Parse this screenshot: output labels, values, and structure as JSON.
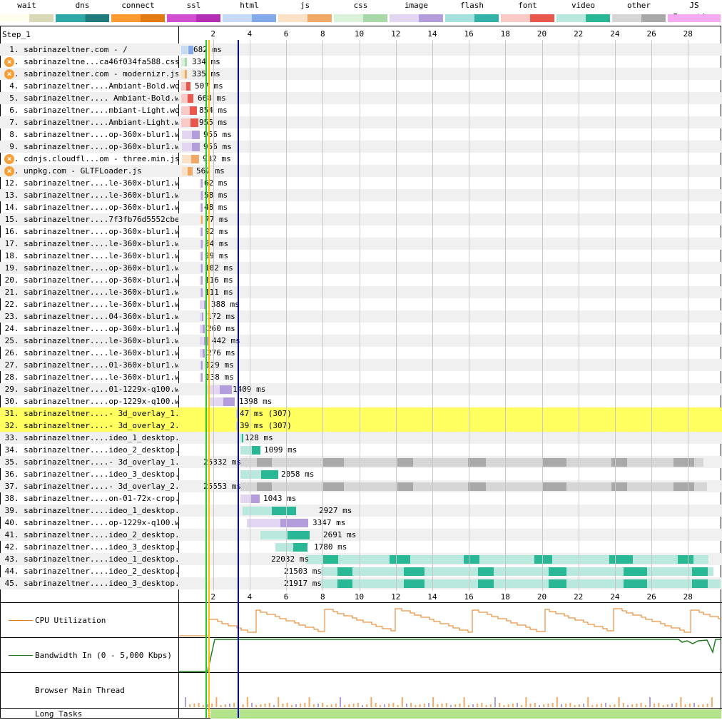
{
  "legend": [
    {
      "label": "wait",
      "colors": [
        "#fffded",
        "#d9d9b8"
      ]
    },
    {
      "label": "dns",
      "colors": [
        "#30a8a8",
        "#1f7a7a"
      ]
    },
    {
      "label": "connect",
      "colors": [
        "#ff9a33",
        "#e37b14"
      ]
    },
    {
      "label": "ssl",
      "colors": [
        "#d150d1",
        "#b52fb5"
      ]
    },
    {
      "label": "html",
      "colors": [
        "#c6d9f5",
        "#82a9e8"
      ]
    },
    {
      "label": "js",
      "colors": [
        "#fbe2c6",
        "#efa866"
      ]
    },
    {
      "label": "css",
      "colors": [
        "#d9f2d9",
        "#a9d9a9"
      ]
    },
    {
      "label": "image",
      "colors": [
        "#e2d6f2",
        "#b39ddb"
      ]
    },
    {
      "label": "flash",
      "colors": [
        "#a6e2dd",
        "#32b2a9"
      ]
    },
    {
      "label": "font",
      "colors": [
        "#f9c9c5",
        "#e8584d"
      ]
    },
    {
      "label": "video",
      "colors": [
        "#b8e8de",
        "#2ab795"
      ]
    },
    {
      "label": "other",
      "colors": [
        "#d6d6d6",
        "#a9a9a9"
      ]
    },
    {
      "label": "JS Execution",
      "colors": [
        "#f7a9f2",
        "#f7a9f2"
      ]
    }
  ],
  "step_title": "Step_1",
  "axis": {
    "ticks": [
      "2",
      "4",
      "6",
      "8",
      "10",
      "12",
      "14",
      "16",
      "18",
      "20",
      "22",
      "24",
      "26",
      "28"
    ]
  },
  "requests": [
    {
      "label": "  1. sabrinazeltner.com - /",
      "timing": "682 ms",
      "type": "html",
      "error": false,
      "highlight": false
    },
    {
      "label": "  2. sabrinazeltne...ca46f034fa588.css",
      "timing": "334 ms",
      "type": "css",
      "error": true,
      "highlight": false
    },
    {
      "label": "  3. sabrinazeltner.com - modernizr.js",
      "timing": "335 ms",
      "type": "js",
      "error": true,
      "highlight": false
    },
    {
      "label": "  4. sabrinazeltner....Ambiant-Bold.woff2",
      "timing": "507 ms",
      "type": "font",
      "error": false,
      "highlight": false
    },
    {
      "label": "  5. sabrinazeltner.... Ambiant-Bold.woff",
      "timing": "668 ms",
      "type": "font",
      "error": false,
      "highlight": false
    },
    {
      "label": "  6. sabrinazeltner....mbiant-Light.woff2",
      "timing": "854 ms",
      "type": "font",
      "error": false,
      "highlight": false
    },
    {
      "label": "  7. sabrinazeltner....Ambiant-Light.woff",
      "timing": "955 ms",
      "type": "font",
      "error": false,
      "highlight": false
    },
    {
      "label": "  8. sabrinazeltner....op-360x-blur1.webp",
      "timing": "956 ms",
      "type": "image",
      "error": false,
      "highlight": false
    },
    {
      "label": "  9. sabrinazeltner....op-360x-blur1.webp",
      "timing": "956 ms",
      "type": "image",
      "error": false,
      "highlight": false
    },
    {
      "label": " 10. cdnjs.cloudfl...om - three.min.js",
      "timing": "932 ms",
      "type": "js",
      "error": true,
      "highlight": false
    },
    {
      "label": " 11. unpkg.com - GLTFLoader.js",
      "timing": "567 ms",
      "type": "js",
      "error": true,
      "highlight": false
    },
    {
      "label": " 12. sabrinazeltner....le-360x-blur1.webp",
      "timing": "62 ms",
      "type": "image",
      "error": false,
      "highlight": false
    },
    {
      "label": " 13. sabrinazeltner....le-360x-blur1.webp",
      "timing": "58 ms",
      "type": "image",
      "error": false,
      "highlight": false
    },
    {
      "label": " 14. sabrinazeltner....op-360x-blur1.webp",
      "timing": "48 ms",
      "type": "image",
      "error": false,
      "highlight": false
    },
    {
      "label": " 15. sabrinazeltner....7f3fb76d5552cbe.js",
      "timing": "77 ms",
      "type": "js",
      "error": false,
      "highlight": false
    },
    {
      "label": " 16. sabrinazeltner....op-360x-blur1.webp",
      "timing": "92 ms",
      "type": "image",
      "error": false,
      "highlight": false
    },
    {
      "label": " 17. sabrinazeltner....le-360x-blur1.webp",
      "timing": "84 ms",
      "type": "image",
      "error": false,
      "highlight": false
    },
    {
      "label": " 18. sabrinazeltner....le-360x-blur1.webp",
      "timing": "99 ms",
      "type": "image",
      "error": false,
      "highlight": false
    },
    {
      "label": " 19. sabrinazeltner....op-360x-blur1.webp",
      "timing": "102 ms",
      "type": "image",
      "error": false,
      "highlight": false
    },
    {
      "label": " 20. sabrinazeltner....op-360x-blur1.webp",
      "timing": "116 ms",
      "type": "image",
      "error": false,
      "highlight": false
    },
    {
      "label": " 21. sabrinazeltner....le-360x-blur1.webp",
      "timing": "111 ms",
      "type": "image",
      "error": false,
      "highlight": false
    },
    {
      "label": " 22. sabrinazeltner....le-360x-blur1.webp",
      "timing": "388 ms",
      "type": "image",
      "error": false,
      "highlight": false
    },
    {
      "label": " 23. sabrinazeltner....04-360x-blur1.webp",
      "timing": "172 ms",
      "type": "image",
      "error": false,
      "highlight": false
    },
    {
      "label": " 24. sabrinazeltner....op-360x-blur1.webp",
      "timing": "260 ms",
      "type": "image",
      "error": false,
      "highlight": false
    },
    {
      "label": " 25. sabrinazeltner....le-360x-blur1.webp",
      "timing": "442 ms",
      "type": "image",
      "error": false,
      "highlight": false
    },
    {
      "label": " 26. sabrinazeltner....le-360x-blur1.webp",
      "timing": "276 ms",
      "type": "image",
      "error": false,
      "highlight": false
    },
    {
      "label": " 27. sabrinazeltner....01-360x-blur1.webp",
      "timing": "129 ms",
      "type": "image",
      "error": false,
      "highlight": false
    },
    {
      "label": " 28. sabrinazeltner....le-360x-blur1.webp",
      "timing": "138 ms",
      "type": "image",
      "error": false,
      "highlight": false
    },
    {
      "label": " 29. sabrinazeltner....01-1229x-q100.webp",
      "timing": "1409 ms",
      "type": "image",
      "error": false,
      "highlight": false
    },
    {
      "label": " 30. sabrinazeltner....op-1229x-q100.webp",
      "timing": "1398 ms",
      "type": "image",
      "error": false,
      "highlight": false
    },
    {
      "label": " 31. sabrinazeltner....- 3d_overlay_1.glb",
      "timing": "47 ms (307)",
      "type": "other",
      "error": false,
      "highlight": true
    },
    {
      "label": " 32. sabrinazeltner....- 3d_overlay_2.glb",
      "timing": "39 ms (307)",
      "type": "other",
      "error": false,
      "highlight": true
    },
    {
      "label": " 33. sabrinazeltner....ideo_1_desktop.mp4",
      "timing": "128 ms",
      "type": "video",
      "error": false,
      "highlight": false
    },
    {
      "label": " 34. sabrinazeltner....ideo_2_desktop.mp4",
      "timing": "1099 ms",
      "type": "video",
      "error": false,
      "highlight": false
    },
    {
      "label": " 35. sabrinazeltner....- 3d_overlay_1.glb",
      "timing": "25332 ms",
      "type": "other",
      "error": false,
      "highlight": false
    },
    {
      "label": " 36. sabrinazeltner....ideo_3_desktop.mp4",
      "timing": "2058 ms",
      "type": "video",
      "error": false,
      "highlight": false
    },
    {
      "label": " 37. sabrinazeltner....- 3d_overlay_2.glb",
      "timing": "25553 ms",
      "type": "other",
      "error": false,
      "highlight": false
    },
    {
      "label": " 38. sabrinazeltner....on-01-72x-crop.png",
      "timing": "1043 ms",
      "type": "image",
      "error": false,
      "highlight": false
    },
    {
      "label": " 39. sabrinazeltner....ideo_1_desktop.mp4",
      "timing": "2927 ms",
      "type": "video",
      "error": false,
      "highlight": false
    },
    {
      "label": " 40. sabrinazeltner....op-1229x-q100.webp",
      "timing": "3347 ms",
      "type": "image",
      "error": false,
      "highlight": false
    },
    {
      "label": " 41. sabrinazeltner....ideo_2_desktop.mp4",
      "timing": "2691 ms",
      "type": "video",
      "error": false,
      "highlight": false
    },
    {
      "label": " 42. sabrinazeltner....ideo_3_desktop.mp4",
      "timing": "1780 ms",
      "type": "video",
      "error": false,
      "highlight": false
    },
    {
      "label": " 43. sabrinazeltner....ideo_1_desktop.mp4",
      "timing": "22032 ms",
      "type": "video",
      "error": false,
      "highlight": false
    },
    {
      "label": " 44. sabrinazeltner....ideo_2_desktop.mp4",
      "timing": "21503 ms",
      "type": "video",
      "error": false,
      "highlight": false
    },
    {
      "label": " 45. sabrinazeltner....ideo_3_desktop.mp4",
      "timing": "21917 ms",
      "type": "video",
      "error": false,
      "highlight": false
    }
  ],
  "graphs": {
    "cpu_label": "CPU Utilization",
    "bandwidth_label": "Bandwidth In (0 - 5,000 Kbps)",
    "main_thread_label": "Browser Main Thread",
    "long_tasks_label": "Long Tasks"
  }
}
